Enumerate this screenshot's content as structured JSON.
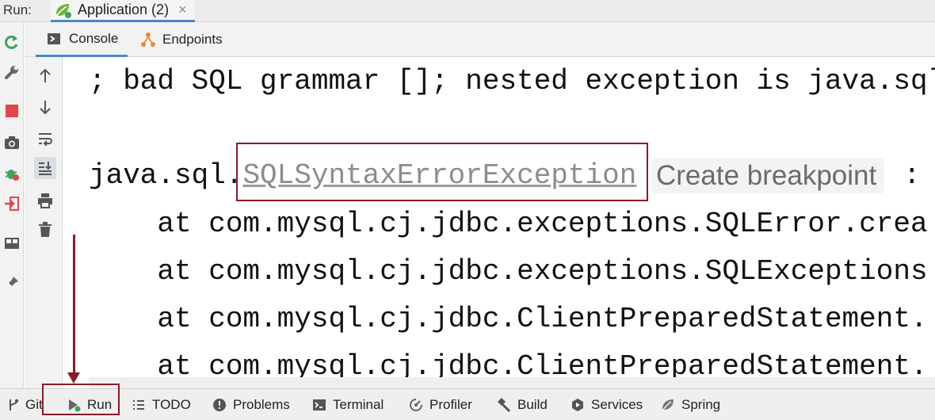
{
  "run_header": {
    "label": "Run:",
    "tab": {
      "title": "Application (2)",
      "close": "×"
    }
  },
  "left_strip": {
    "icons": [
      "rerun-icon",
      "wrench-icon",
      "stop-icon",
      "camera-icon",
      "debug-bug-icon",
      "exit-icon",
      "layout-icon",
      "pin-icon"
    ]
  },
  "console_tabs": [
    {
      "label": "Console",
      "icon": "console-icon",
      "active": true
    },
    {
      "label": "Endpoints",
      "icon": "endpoints-icon",
      "active": false
    }
  ],
  "console_toolbar": {
    "icons": [
      "arrow-up-icon",
      "arrow-down-icon",
      "soft-wrap-icon",
      "scroll-to-end-icon",
      "print-icon",
      "trash-icon"
    ]
  },
  "console": {
    "line1": "; bad SQL grammar []; nested exception is java.sql",
    "line2_prefix": "java.sql.",
    "line2_exception": "SQLSyntaxErrorException",
    "line2_suffix": ":",
    "breakpoint_hint": "Create breakpoint",
    "stack": [
      "    at com.mysql.cj.jdbc.exceptions.SQLError.crea",
      "    at com.mysql.cj.jdbc.exceptions.SQLExceptions",
      "    at com.mysql.cj.jdbc.ClientPreparedStatement.",
      "    at com.mysql.cj.jdbc.ClientPreparedStatement."
    ]
  },
  "bottom_bar": {
    "items": [
      {
        "label": "Git",
        "icon": "git-branch-icon"
      },
      {
        "label": "Run",
        "icon": "run-icon"
      },
      {
        "label": "TODO",
        "icon": "todo-list-icon"
      },
      {
        "label": "Problems",
        "icon": "problems-icon"
      },
      {
        "label": "Terminal",
        "icon": "terminal-icon"
      },
      {
        "label": "Profiler",
        "icon": "profiler-icon"
      },
      {
        "label": "Build",
        "icon": "build-hammer-icon"
      },
      {
        "label": "Services",
        "icon": "services-icon"
      },
      {
        "label": "Spring",
        "icon": "spring-leaf-icon"
      }
    ]
  },
  "colors": {
    "annotation_red": "#8b1a2a",
    "tab_underline": "#4a88c7",
    "stop_red": "#e0474c",
    "run_green": "#3ba55c"
  }
}
